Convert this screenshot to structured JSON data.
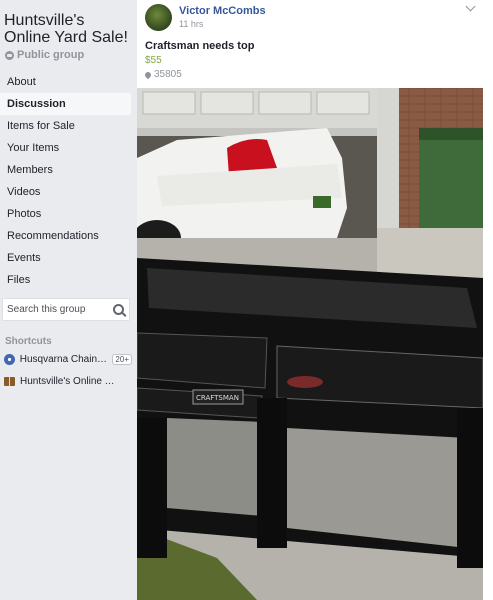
{
  "group": {
    "name": "Huntsville's Online Yard Sale!",
    "privacy": "Public group"
  },
  "nav": [
    {
      "label": "About"
    },
    {
      "label": "Discussion",
      "active": true
    },
    {
      "label": "Items for Sale"
    },
    {
      "label": "Your Items"
    },
    {
      "label": "Members"
    },
    {
      "label": "Videos"
    },
    {
      "label": "Photos"
    },
    {
      "label": "Recommendations"
    },
    {
      "label": "Events"
    },
    {
      "label": "Files"
    }
  ],
  "search": {
    "placeholder": "Search this group"
  },
  "shortcuts": {
    "heading": "Shortcuts",
    "items": [
      {
        "label": "Husqvarna Chains...",
        "badge": "20+",
        "icon": "group-icon"
      },
      {
        "label": "Huntsville's Online Yard...",
        "icon": "book-icon"
      }
    ]
  },
  "post": {
    "author": "Victor McCombs",
    "time": "11 hrs",
    "title": "Craftsman needs top",
    "price": "$55",
    "location": "35805"
  },
  "colors": {
    "link": "#365899",
    "price": "#7fa842",
    "muted": "#90949c",
    "sidebar_bg": "#e9ebee"
  }
}
